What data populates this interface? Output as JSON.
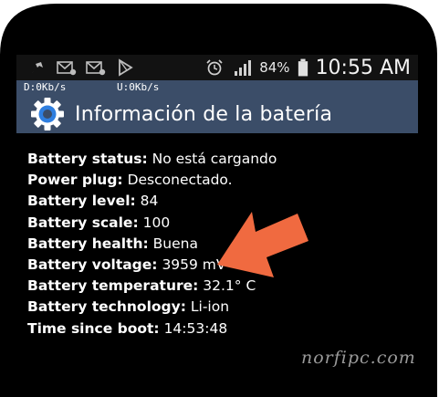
{
  "status_bar": {
    "notification_icons": [
      "pin-icon",
      "mail-icon",
      "mail-icon",
      "play-store-icon"
    ],
    "alarm_icon": "alarm-clock-icon",
    "signal_icon": "signal-bars-icon",
    "battery_percent": "84%",
    "battery_icon": "battery-icon",
    "time": "10:55 AM"
  },
  "network": {
    "download": "D:0Kb/s",
    "upload": "U:0Kb/s"
  },
  "app_bar": {
    "icon": "gear-icon",
    "title": "Información de la batería",
    "accent": "#3b4d68"
  },
  "battery_info": [
    {
      "label": "Battery status:",
      "value": "No está cargando"
    },
    {
      "label": "Power plug:",
      "value": "Desconectado."
    },
    {
      "label": "Battery level:",
      "value": "84"
    },
    {
      "label": "Battery scale:",
      "value": "100"
    },
    {
      "label": "Battery health:",
      "value": "Buena"
    },
    {
      "label": "Battery voltage:",
      "value": "3959 mV"
    },
    {
      "label": "Battery temperature:",
      "value": "32.1° C"
    },
    {
      "label": "Battery technology:",
      "value": "Li-ion"
    },
    {
      "label": "Time since boot:",
      "value": "14:53:48"
    }
  ],
  "annotation": {
    "icon": "arrow-icon",
    "color": "#f06a40"
  },
  "watermark": "norfipc.com"
}
